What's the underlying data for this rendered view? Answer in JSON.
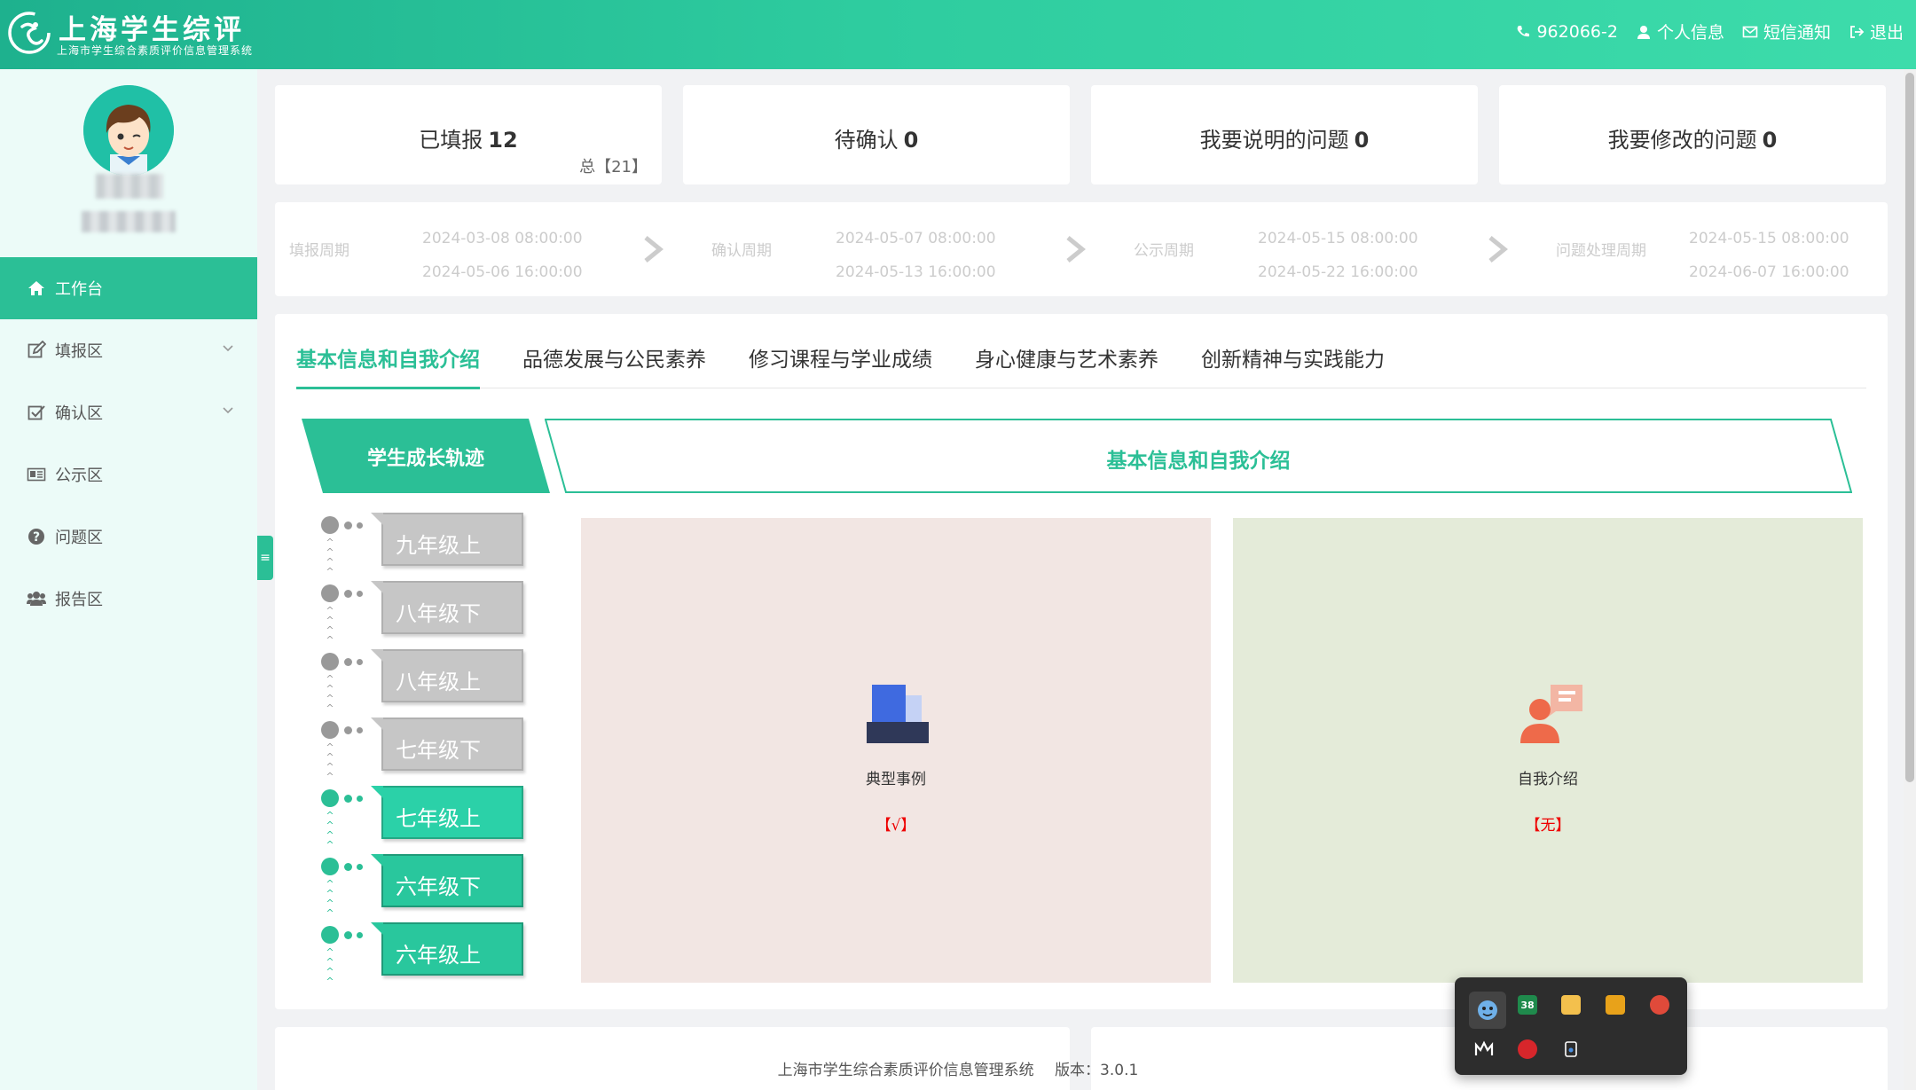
{
  "header": {
    "brand_title": "上海学生综评",
    "brand_sub": "上海市学生综合素质评价信息管理系统",
    "hotline": "962066-2",
    "personal_info": "个人信息",
    "sms_notice": "短信通知",
    "logout": "退出"
  },
  "sidebar": {
    "items": [
      {
        "label": "工作台",
        "icon": "home-icon"
      },
      {
        "label": "填报区",
        "icon": "edit-icon"
      },
      {
        "label": "确认区",
        "icon": "check-square-icon"
      },
      {
        "label": "公示区",
        "icon": "newspaper-icon"
      },
      {
        "label": "问题区",
        "icon": "question-circle-icon"
      },
      {
        "label": "报告区",
        "icon": "users-icon"
      }
    ],
    "collapse_symbol": "≡"
  },
  "stats": [
    {
      "label": "已填报",
      "value": "12",
      "sub": "总【21】"
    },
    {
      "label": "待确认",
      "value": "0"
    },
    {
      "label": "我要说明的问题",
      "value": "0"
    },
    {
      "label": "我要修改的问题",
      "value": "0"
    }
  ],
  "periods": [
    {
      "label": "填报周期",
      "start": "2024-03-08 08:00:00",
      "end": "2024-05-06 16:00:00"
    },
    {
      "label": "确认周期",
      "start": "2024-05-07 08:00:00",
      "end": "2024-05-13 16:00:00"
    },
    {
      "label": "公示周期",
      "start": "2024-05-15 08:00:00",
      "end": "2024-05-22 16:00:00"
    },
    {
      "label": "问题处理周期",
      "start": "2024-05-15 08:00:00",
      "end": "2024-06-07 16:00:00"
    }
  ],
  "tabs": [
    {
      "label": "基本信息和自我介绍",
      "active": true
    },
    {
      "label": "品德发展与公民素养"
    },
    {
      "label": "修习课程与学业成绩"
    },
    {
      "label": "身心健康与艺术素养"
    },
    {
      "label": "创新精神与实践能力"
    }
  ],
  "track_tab": "学生成长轨迹",
  "section_title": "基本信息和自我介绍",
  "grades": [
    {
      "label": "九年级上",
      "state": "inactive"
    },
    {
      "label": "八年级下",
      "state": "inactive"
    },
    {
      "label": "八年级上",
      "state": "inactive"
    },
    {
      "label": "七年级下",
      "state": "inactive"
    },
    {
      "label": "七年级上",
      "state": "active-light"
    },
    {
      "label": "六年级下",
      "state": "active"
    },
    {
      "label": "六年级上",
      "state": "active"
    }
  ],
  "cards": [
    {
      "label": "典型事例",
      "status": "【√】",
      "icon": "inbox-document-icon"
    },
    {
      "label": "自我介绍",
      "status": "【无】",
      "icon": "person-speech-icon"
    }
  ],
  "footer": {
    "text": "上海市学生综合素质评价信息管理系统",
    "version": "版本：3.0.1"
  },
  "tray": {
    "badge_count": "38"
  },
  "colors": {
    "accent": "#2bbf96",
    "header_gradient_start": "#1eb18e",
    "header_gradient_end": "#3ddcab",
    "status_red": "#e00000"
  }
}
